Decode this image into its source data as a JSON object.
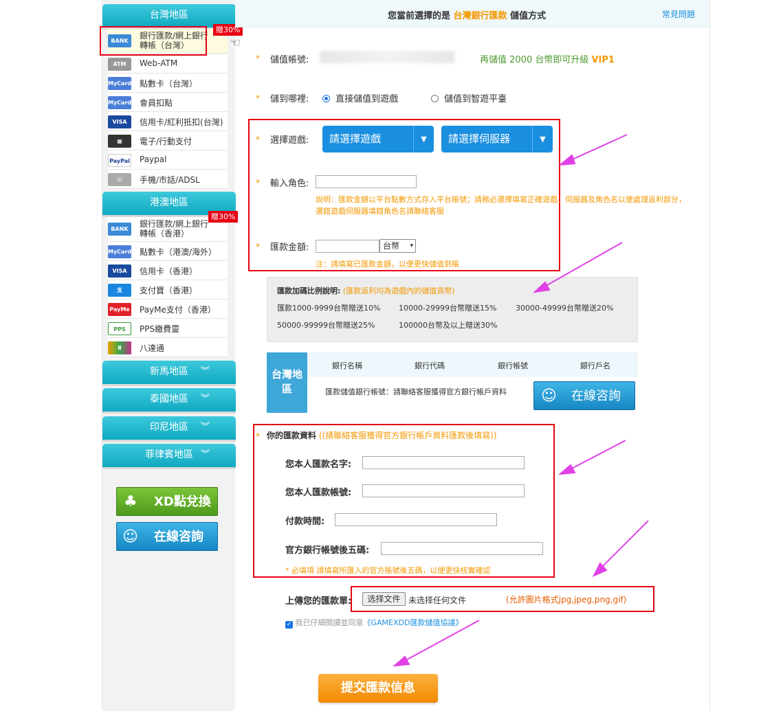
{
  "sidebar": {
    "taiwan": {
      "title": "台灣地區",
      "items": [
        {
          "label": "銀行匯款/網上銀行轉帳（台灣）",
          "icon": "bank-icon",
          "badge": "贈30%"
        },
        {
          "label": "Web-ATM",
          "icon": "atm-icon"
        },
        {
          "label": "點數卡（台灣）",
          "icon": "mycard-icon"
        },
        {
          "label": "會員扣點",
          "icon": "mycard-icon"
        },
        {
          "label": "信用卡/紅利抵扣(台灣)",
          "icon": "visa-icon"
        },
        {
          "label": "電子/行動支付",
          "icon": "qrcode-icon"
        },
        {
          "label": "Paypal",
          "icon": "paypal-icon"
        },
        {
          "label": "手機/市話/ADSL",
          "icon": "phone-icon"
        }
      ]
    },
    "hkmo": {
      "title": "港澳地區",
      "items": [
        {
          "label": "銀行匯款/網上銀行轉帳（香港）",
          "icon": "bank-icon",
          "badge": "贈30%"
        },
        {
          "label": "點數卡（港澳/海外）",
          "icon": "mycard-icon"
        },
        {
          "label": "信用卡（香港）",
          "icon": "visa-icon"
        },
        {
          "label": "支付寶（香港）",
          "icon": "alipay-icon"
        },
        {
          "label": "PayMe支付（香港）",
          "icon": "payme-icon"
        },
        {
          "label": "PPS繳費靈",
          "icon": "pps-icon"
        },
        {
          "label": "八達通",
          "icon": "octopus-icon"
        }
      ]
    },
    "collapsed_regions": [
      "新馬地區",
      "泰國地區",
      "印尼地區",
      "菲律賓地區"
    ],
    "xd_button": "XD點兌換",
    "chat_button": "在線咨詢"
  },
  "header": {
    "prefix": "您當前選擇的是",
    "method": "台灣銀行匯款",
    "suffix": "儲值方式",
    "faq": "常見問題"
  },
  "form": {
    "account_label": "儲值帳號:",
    "upgrade_prefix": "再儲值 2000 台幣即可升級",
    "upgrade_vip": "VIP1",
    "target_label": "儲到哪裡:",
    "target_options": [
      "直接儲值到遊戲",
      "儲值到智遊平臺"
    ],
    "game_label": "選擇遊戲:",
    "game_select": "請選擇遊戲",
    "server_select": "請選擇伺服器",
    "role_label": "輸入角色:",
    "role_note": "說明：匯款金額以平台點數方式存入平台賬號；請務必選擇填寫正確遊戲、伺服器及角色名以便處理返利部分，選錯遊戲伺服器填錯角色名請聯絡客服",
    "amount_label": "匯款金額:",
    "currency": "台幣",
    "amount_note": "注：請填寫已匯款金額，以便更快儲值到賬"
  },
  "bonus": {
    "title": "匯款加碼比例說明:",
    "title_note": "(匯款返利均為遊戲內的儲值貨幣)",
    "rows": [
      [
        "匯款1000-9999台幣贈送10%",
        "10000-29999台幣贈送15%",
        "30000-49999台幣贈送20%"
      ],
      [
        "50000-99999台幣贈送25%",
        "100000台幣及以上贈送30%"
      ]
    ]
  },
  "bank_table": {
    "region": "台灣地區",
    "headers": [
      "銀行名稱",
      "銀行代碼",
      "銀行帳號",
      "銀行戶名"
    ],
    "note": "匯款儲值銀行帳號：請聯絡客服獲得官方銀行帳戶資料",
    "chat_button": "在線咨詢"
  },
  "remit": {
    "title": "你的匯款資料",
    "title_note": "((請聯絡客服獲得官方銀行帳戶資料匯款後填寫))",
    "name_label": "您本人匯款名字:",
    "account_label": "您本人匯款帳號:",
    "time_label": "付款時間:",
    "last5_label": "官方銀行帳號後五碼:",
    "note": "* 必填項 請填寫所匯入的官方賬號後五碼，以便更快核實確認"
  },
  "upload": {
    "label": "上傳您的匯款單:",
    "choose": "选择文件",
    "no_file": "未选择任何文件",
    "formats": "(允許圖片格式jpg,jpeg,png,gif)"
  },
  "agree": {
    "prefix": "我已仔細閱讀並同意",
    "link": "《GAMEXDD匯款儲值協議》"
  },
  "submit": "提交匯款信息",
  "colors": {
    "accent": "#0fa9c1",
    "orange": "#f39800",
    "red": "#e60012",
    "magenta": "#e040e6",
    "blue": "#1a8fe0"
  }
}
